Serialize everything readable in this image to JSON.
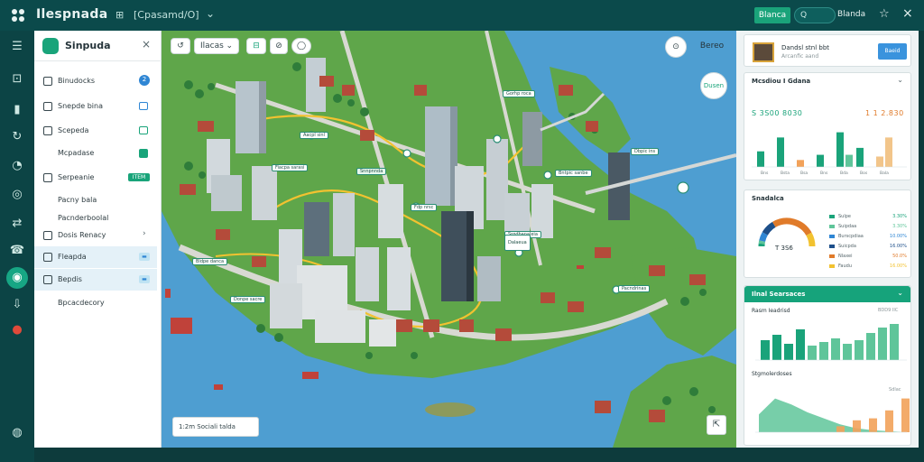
{
  "topbar": {
    "title": "Ilespnada",
    "path_icon": "⊞",
    "path": "[Cpasamd/O]",
    "chevron": "⌄",
    "green_button": "Blanca",
    "toggle_label": "Q",
    "user_label": "Blanda",
    "pin_icon": "☆",
    "close_icon": "×"
  },
  "rail": {
    "icons": [
      "menu-icon",
      "camera-icon",
      "book-icon",
      "refresh-icon",
      "pie-icon",
      "target-icon",
      "route-icon",
      "phone-icon",
      "active-circle-icon",
      "download-icon",
      "red-dot-icon",
      "globe-icon"
    ]
  },
  "sidepanel": {
    "title": "Sinpuda",
    "close": "×",
    "items": [
      {
        "label": "Binudocks",
        "badge": "2"
      },
      {
        "label": "Snepde bina",
        "badge": ""
      },
      {
        "label": "Scepeda",
        "badge": ""
      },
      {
        "label": "Mcpadase",
        "badge": ""
      },
      {
        "label": "Serpeanie",
        "badge": "ITEM"
      },
      {
        "label": "Pacny bala",
        "badge": ""
      },
      {
        "label": "Pacnderboolal",
        "badge": ""
      },
      {
        "label": "Dosis Renacy",
        "badge": "›"
      },
      {
        "label": "Fleapda",
        "badge": "▬"
      },
      {
        "label": "Bepdis",
        "badge": "▬"
      },
      {
        "label": "Bpcacdecory",
        "badge": ""
      }
    ]
  },
  "map": {
    "toolbar": {
      "undo": "↺",
      "select_label": "Ilacas",
      "select_chev": "⌄",
      "layer_tag": "⊟",
      "compass": "⊘",
      "shape": "◯"
    },
    "search_icon": "⊙",
    "search_label": "Bereo",
    "zoom_label": "Dusen",
    "scale_text": "1:2m  Sociali talda",
    "compass_icon": "⇱",
    "tags": [
      "Aacpl sinl",
      "Fiacpa sarasi",
      "Snnpnnda",
      "Gorhp  roca",
      "Bntpic sanbe",
      "Dbpic ins",
      "Fdp nrsc",
      "Srgdbanaleia",
      "Pacndrinas",
      "Bldpe danca",
      "Donpe sacre",
      "Dalaeua"
    ]
  },
  "rightpanel": {
    "user": {
      "name": "Dandsl stnl bbt",
      "sub": "Arcanfic aand",
      "button": "Baeid"
    },
    "stats_card": {
      "title": "Mcsdiou I Gdana",
      "stat_a": "S 3S00  8030",
      "stat_b": "1 1 2.830"
    },
    "gauge_card": {
      "title": "Snadalca",
      "value": "T 3S6",
      "legend": [
        {
          "label": "Sulpe",
          "value": "3.30%"
        },
        {
          "label": "Suipdaa",
          "value": "3.30%"
        },
        {
          "label": "Burscpdiaa",
          "value": "10.00%"
        },
        {
          "label": "Suicpda",
          "value": "16.00%"
        },
        {
          "label": "Nlaxei",
          "value": "50.0%"
        },
        {
          "label": "Faudu",
          "value": "16.00%"
        }
      ]
    },
    "trend_card": {
      "title": "Ilnal Searsaces",
      "sub1": "Rasm Ieadrisd",
      "sub1_right": "BDD9 IIC",
      "sub2": "Stgmolerdoses",
      "sub2_right": "Sdlac"
    }
  },
  "chart_data": [
    {
      "type": "bar",
      "title": "Mcsdiou I Gdana",
      "categories": [
        "Bns",
        "Bsta",
        "Bsa",
        "Bns",
        "Bda",
        "Bos",
        "Bala"
      ],
      "series": [
        {
          "values": [
            18,
            34,
            8,
            14,
            40,
            22,
            12
          ]
        },
        {
          "values": [
            0,
            0,
            0,
            0,
            14,
            0,
            34
          ]
        }
      ]
    },
    {
      "type": "pie",
      "title": "Snadalca",
      "categories": [
        "Sulpe",
        "Suipdaa",
        "Burscpdiaa",
        "Suicpda",
        "Nlaxei",
        "Faudu"
      ],
      "values": [
        3.3,
        3.3,
        10.0,
        16.0,
        50.0,
        16.0
      ]
    },
    {
      "type": "bar",
      "title": "Rasm Ieadrisd",
      "series": [
        {
          "values": [
            22,
            28,
            18,
            34,
            16,
            20,
            24,
            18,
            22,
            30,
            36,
            40
          ]
        }
      ]
    },
    {
      "type": "area",
      "title": "Stgmolerdoses",
      "series": [
        {
          "values": [
            18,
            34,
            28,
            20,
            14,
            8,
            4,
            2,
            1,
            0
          ]
        },
        {
          "values": [
            0,
            0,
            0,
            0,
            0,
            6,
            12,
            14,
            22,
            34
          ]
        }
      ]
    }
  ]
}
